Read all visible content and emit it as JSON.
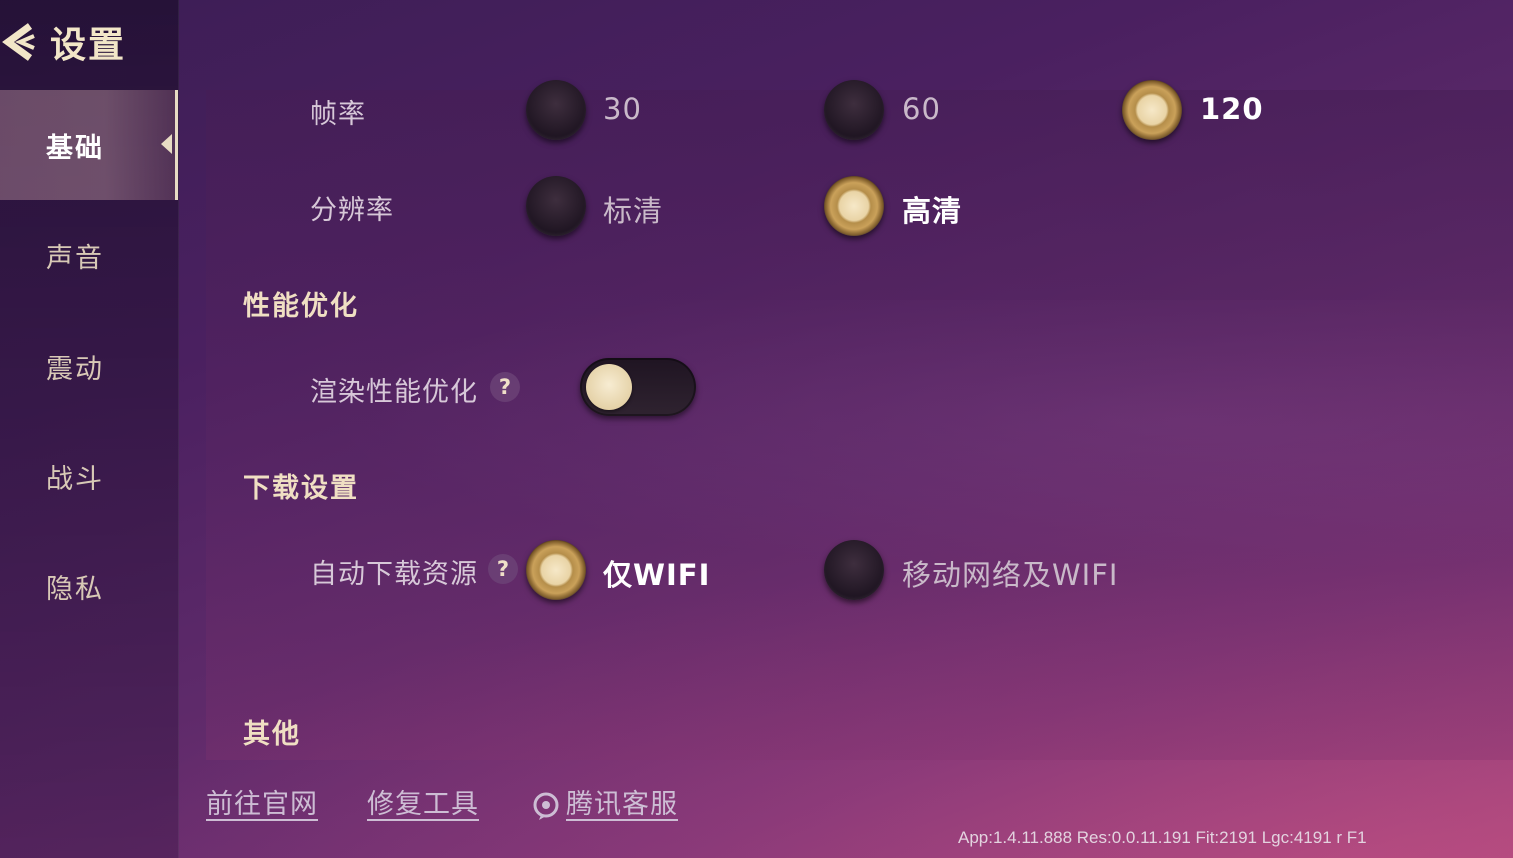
{
  "header": {
    "title": "设置"
  },
  "sidebar": {
    "items": [
      {
        "label": "基础",
        "active": true
      },
      {
        "label": "声音",
        "active": false
      },
      {
        "label": "震动",
        "active": false
      },
      {
        "label": "战斗",
        "active": false
      },
      {
        "label": "隐私",
        "active": false
      }
    ]
  },
  "settings": {
    "frame_rate": {
      "label": "帧率",
      "options": [
        "30",
        "60",
        "120"
      ],
      "selected": "120"
    },
    "resolution": {
      "label": "分辨率",
      "options": [
        "标清",
        "高清"
      ],
      "selected": "高清"
    },
    "performance": {
      "section_title": "性能优化",
      "render_opt": {
        "label": "渲染性能优化",
        "help": "?",
        "enabled": false
      }
    },
    "download": {
      "section_title": "下载设置",
      "auto_download": {
        "label": "自动下载资源",
        "help": "?",
        "options": [
          "仅WIFI",
          "移动网络及WIFI"
        ],
        "selected": "仅WIFI"
      }
    },
    "other": {
      "section_title": "其他"
    }
  },
  "footer": {
    "links": [
      "前往官网",
      "修复工具",
      "腾讯客服"
    ],
    "version": "App:1.4.11.888 Res:0.0.11.191 Fit:2191 Lgc:4191 r F1"
  },
  "colors": {
    "accent_gold": "#caa15a",
    "cream": "#f2e6c8",
    "bg_purple": "#4a2060"
  },
  "icons": [
    "back-arrow-icon",
    "help-icon",
    "customer-service-icon"
  ]
}
